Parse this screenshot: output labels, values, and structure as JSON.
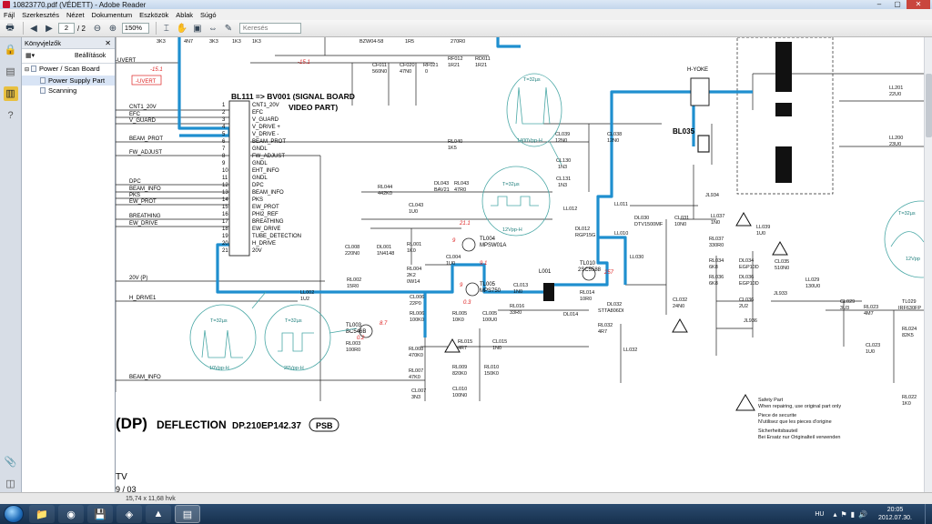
{
  "window": {
    "title": "10823770.pdf (VÉDETT) - Adobe Reader",
    "controls": [
      "–",
      "▢",
      "✕"
    ]
  },
  "menu": [
    "Fájl",
    "Szerkesztés",
    "Nézet",
    "Dokumentum",
    "Eszközök",
    "Ablak",
    "Súgó"
  ],
  "toolbar": {
    "page_current": "2",
    "page_total": "/ 2",
    "zoom": "150%",
    "search_placeholder": "Keresés"
  },
  "bookmarks": {
    "title": "Könyvjelzők",
    "options": "Beállítások",
    "items": [
      {
        "label": "Power / Scan Board"
      },
      {
        "label": "Power Supply Part"
      },
      {
        "label": "Scanning"
      }
    ]
  },
  "statusbar": {
    "size": "15,74 x 11,68 hvk"
  },
  "taskbar": {
    "lang": "HU",
    "time": "20:05",
    "date": "2012.07.30."
  },
  "schematic": {
    "title_prefix": "(DP)",
    "title": "DEFLECTION",
    "code": "DP.210EP142.37",
    "badge": "PSB",
    "bl111_title": "BL111 => BV001 (SIGNAL BOARD",
    "bl111_sub": "VIDEO PART)",
    "pins": [
      "CNT1_20V",
      "EFC",
      "V_GUARD",
      "V_DRIVE +",
      "V_DRIVE -",
      "BEAM_PROT",
      "GNDL",
      "FW_ADJUST",
      "GNDL",
      "EHT_INFO",
      "GNDL",
      "DPC",
      "BEAM_INFO",
      "PKS",
      "EW_PROT",
      "PHI2_REF",
      "BREATHING",
      "EW_DRIVE",
      "TUBE_DETECTION",
      "H_DRIVE",
      "20V"
    ],
    "left_signals": [
      "CNT1_20V",
      "EFC",
      "V_GUARD",
      "BEAM_PROT",
      "FW_ADJUST",
      "DPC",
      "BEAM_INFO",
      "PKS",
      "EW_PROT",
      "BREATHING",
      "EW_DRIVE",
      "20V (P)",
      "H_DRIVE1",
      "BEAM_INFO"
    ],
    "safety": {
      "line1": "Safety Part",
      "line2": "When repairing, use original part only",
      "line3": "Piece de securite",
      "line4": "N'utilisez que les pieces d'origine",
      "line5": "Sicherheitsbauteil",
      "line6": "Bei Ersatz nur Originalteil verwenden"
    },
    "waveforms": [
      {
        "label": "T=32µs",
        "amp": "1400Vpp-H"
      },
      {
        "label": "T=32µs",
        "amp": "12Vpp-H"
      },
      {
        "label": "T=32µs",
        "amp": "10Vpp-H"
      },
      {
        "label": "T=32µs",
        "amp": "20Vpp-H"
      },
      {
        "label": "T=32µs",
        "amp": "12Vpp"
      }
    ],
    "components": [
      "TL004 MPSW01A",
      "TL005 MPS750",
      "TL003 BC546B",
      "TL010 2SC5588",
      "L001",
      "BL035",
      "H-YOKE",
      "DL030 DTV1500MF",
      "DL032 STTA806DI",
      "RL002 15R0",
      "LL002 1U2",
      "CL006 22P0",
      "RL006 100K0",
      "RL005 10K0",
      "CL013 1N0",
      "RL016 33R0",
      "RL014 10R0",
      "CL032 24N0",
      "CL031 10N0",
      "RL044 442K0",
      "DL043 BAV21",
      "RL043 47R0",
      "CL043 1U0",
      "RL040 1K5",
      "CL039 12N0",
      "CL038 12N0",
      "CL130 1N3",
      "CL131 1N3",
      "DL012 RGP15G",
      "LL012",
      "LL011",
      "LL010",
      "LL030",
      "LL032",
      "RL032 4R7",
      "DL014",
      "CL005 100U0",
      "RL015 4R7",
      "CL015 1N0",
      "RL009 820K0",
      "RL010 150K0",
      "CL010 100N0",
      "RL008 470K0",
      "RL007 47K0",
      "CL007 3N3",
      "RL003 100R0",
      "CL008 220N0",
      "DL001 1N4148",
      "RL001 1K0",
      "RL004 2K2",
      "CL004 1U0",
      "RL034 6K8",
      "RL036 6K8",
      "DL034 EGP10D",
      "DL036 EGP10D",
      "CL036 2U2",
      "JL934",
      "JL933",
      "JL936",
      "LL037 1N0",
      "RL037 330R0",
      "LL039 1U0",
      "CL035 510N0",
      "LL029 130U0",
      "CL029 3U3",
      "RL023 4M7",
      "TL029 IRF630FP",
      "CL023 1U0",
      "RL024 82K5",
      "RL022 1K0",
      "LL201 22U0",
      "LL200 23U0",
      "CF011 560N0",
      "CF020 47N0",
      "RF021 0",
      "RF011 1R21",
      "RD011 1R21",
      "BZW04-58",
      "1R5",
      "270R0"
    ],
    "net_values": [
      "21.1",
      "9",
      "9",
      "9.1",
      "0.3",
      "8.7",
      "0.2",
      "257",
      "-15.1",
      "-15.1"
    ],
    "supply_label": "-UVERT",
    "bottom_text": "TV",
    "bottom_date": "9 / 03"
  }
}
